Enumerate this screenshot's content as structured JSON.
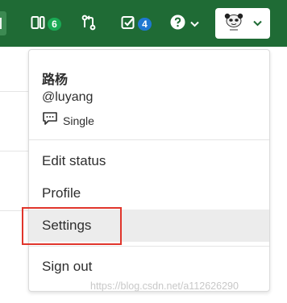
{
  "navbar": {
    "merge_requests_count": "6",
    "todos_count": "4",
    "colors": {
      "background": "#1f6b35",
      "green_badge": "#1aaa55",
      "blue_badge": "#1f78d1"
    }
  },
  "user_menu": {
    "name": "路杨",
    "username": "@luyang",
    "status": "Single",
    "items": [
      {
        "label": "Edit status"
      },
      {
        "label": "Profile"
      },
      {
        "label": "Settings"
      },
      {
        "label": "Sign out"
      }
    ]
  },
  "watermark": "https://blog.csdn.net/a112626290",
  "icons": [
    "sidebar-toggle-icon",
    "merge-request-icon",
    "git-compare-icon",
    "todo-check-icon",
    "help-icon",
    "chevron-down-icon",
    "speech-bubble-icon"
  ],
  "highlight_color": "#e0352b"
}
